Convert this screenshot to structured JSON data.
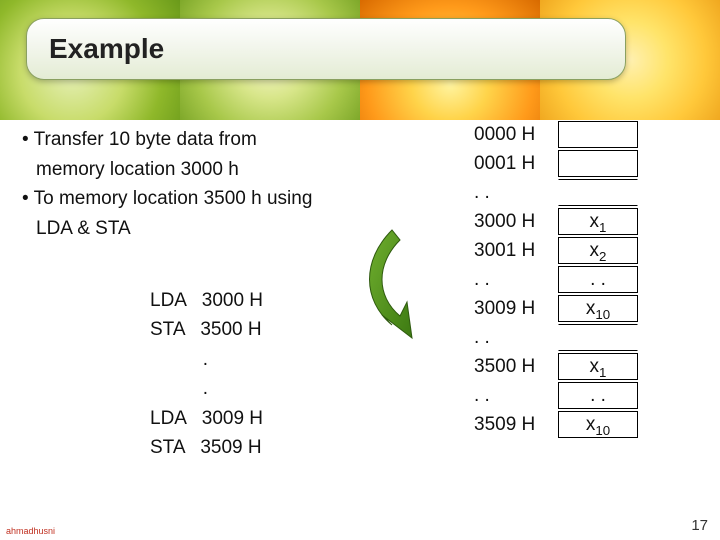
{
  "title": "Example",
  "bullets": [
    {
      "line1": "Transfer 10 byte data from",
      "line2": "memory location 3000 h"
    },
    {
      "line1": "To memory location 3500 h using",
      "line2": "LDA & STA"
    }
  ],
  "code": [
    {
      "op": "LDA",
      "arg": "3000 H"
    },
    {
      "op": "STA",
      "arg": "3500 H"
    },
    {
      "op": "",
      "arg": "."
    },
    {
      "op": "",
      "arg": "."
    },
    {
      "op": "LDA",
      "arg": "3009 H"
    },
    {
      "op": "STA",
      "arg": "3509 H"
    }
  ],
  "mem": {
    "rows": [
      {
        "addr": "0000 H",
        "val": ""
      },
      {
        "addr": "0001 H",
        "val": ""
      },
      {
        "addr": ". .",
        "val": "",
        "gap": true
      },
      {
        "addr": "3000 H",
        "val": "x",
        "sub": "1"
      },
      {
        "addr": "3001 H",
        "val": "x",
        "sub": "2"
      },
      {
        "addr": ". .",
        "val": ". ."
      },
      {
        "addr": "3009 H",
        "val": "x",
        "sub": "10"
      },
      {
        "addr": ". .",
        "val": "",
        "gap": true
      },
      {
        "addr": "3500 H",
        "val": "x",
        "sub": "1"
      },
      {
        "addr": ". .",
        "val": ". ."
      },
      {
        "addr": "3509 H",
        "val": "x",
        "sub": "10"
      }
    ]
  },
  "footer": {
    "left": "ahmadhusni",
    "right": "17"
  }
}
